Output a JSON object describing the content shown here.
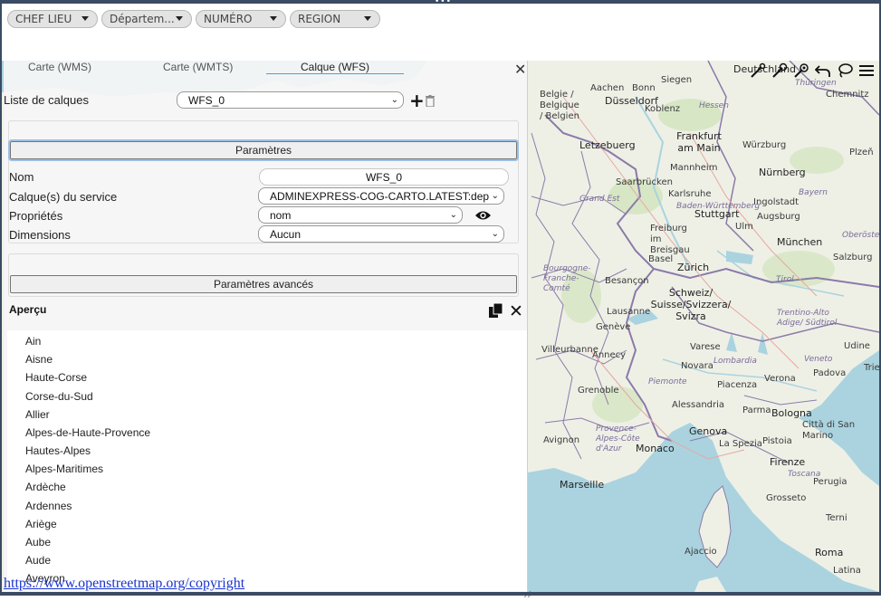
{
  "filters": [
    {
      "label": "CHEF LIEU"
    },
    {
      "label": "Départem..."
    },
    {
      "label": "NUMÉRO"
    },
    {
      "label": "REGION"
    }
  ],
  "panel": {
    "tabs": [
      {
        "label": "Carte (WMS)"
      },
      {
        "label": "Carte (WMTS)"
      },
      {
        "label": "Calque (WFS)"
      }
    ],
    "layer_list_label": "Liste de calques",
    "layer_selected": "WFS_0",
    "parametres_title": "Paramètres",
    "fields": {
      "nom_label": "Nom",
      "nom_value": "WFS_0",
      "service_label": "Calque(s) du service",
      "service_value": "ADMINEXPRESS-COG-CARTO.LATEST:dep",
      "proprietes_label": "Propriétés",
      "proprietes_value": "nom",
      "dimensions_label": "Dimensions",
      "dimensions_value": "Aucun"
    },
    "advanced_title": "Paramètres avancés",
    "apercu_label": "Aperçu",
    "preview_items": [
      "Ain",
      "Aisne",
      "Haute-Corse",
      "Corse-du-Sud",
      "Allier",
      "Alpes-de-Haute-Provence",
      "Hautes-Alpes",
      "Alpes-Maritimes",
      "Ardèche",
      "Ardennes",
      "Ariège",
      "Aube",
      "Aude",
      "Aveyron"
    ]
  },
  "map": {
    "labels": [
      "Düsseldorf",
      "Siegen",
      "Aachen",
      "Bonn",
      "Koblenz",
      "Hessen",
      "Belgie / Belgique / Belgien",
      "Frankfurt am Main",
      "Würzburg",
      "Letzebuerg",
      "Mannheim",
      "Nürnberg",
      "Saarbrücken",
      "Karlsruhe",
      "Ingolstadt",
      "Bayern",
      "Stuttgart",
      "Baden-Württemberg",
      "Augsburg",
      "Grand Est",
      "Ulm",
      "Freiburg im Breisgau",
      "München",
      "Salzburg",
      "Basel",
      "Zürich",
      "Bourgogne-Franche-Comté",
      "Besançon",
      "Schweiz/ Suisse/Svizzera/ Svizra",
      "Tirol",
      "Lausanne",
      "Genève",
      "Trentino-Alto Adige/ Südtirol",
      "Villeurbanne",
      "Annecy",
      "Varese",
      "Udine",
      "Grenoble",
      "Novara",
      "Lombardia",
      "Veneto",
      "Padova",
      "Trieste",
      "Piemonte",
      "Piacenza",
      "Verona",
      "Alessandria",
      "Parma",
      "Bologna",
      "Avignon",
      "Provence-Alpes-Côte d'Azur",
      "Monaco",
      "Genova",
      "Città di San Marino",
      "Pistoia",
      "La Spezia",
      "Firenze",
      "Marseille",
      "Toscana",
      "Perugia",
      "Grosseto",
      "Terni",
      "Ajaccio",
      "Roma",
      "Latina",
      "Deutschland",
      "Thüringen",
      "Chemnitz",
      "Plzeň",
      "Oberöster"
    ],
    "copyright": "https://www.openstreetmap.org/copyright",
    "colors": {
      "land": "#eef0e6",
      "sea": "#aad3df",
      "border": "#8c7aa8",
      "forest": "#cde2b6"
    }
  }
}
